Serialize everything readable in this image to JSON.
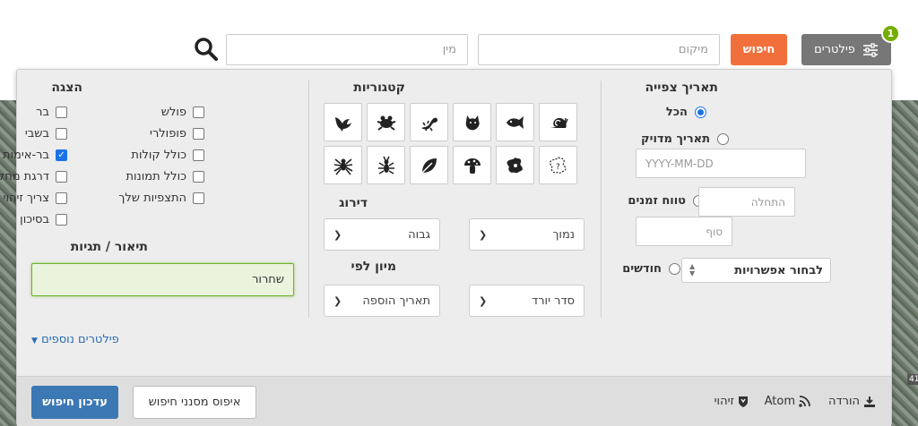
{
  "search": {
    "taxon_placeholder": "מין",
    "place_placeholder": "מיקום",
    "go_label": "חיפוש",
    "filters_label": "פילטרים",
    "filters_count": "1"
  },
  "date": {
    "heading": "תאריך צפייה",
    "any_label": "הכל",
    "exact_label": "תאריך מדויק",
    "exact_placeholder": "YYYY-MM-DD",
    "range_label": "טווח זמנים",
    "range_start_placeholder": "התחלה",
    "range_end_placeholder": "סוף",
    "months_label": "חודשים",
    "months_select": "לבחור אפשרויות"
  },
  "categories": {
    "heading": "קטגוריות",
    "icons": [
      "bird-icon",
      "amphibian-icon",
      "reptile-icon",
      "mammal-icon",
      "fish-icon",
      "mollusk-icon",
      "arachnid-icon",
      "insect-icon",
      "plant-icon",
      "fungi-icon",
      "protozoa-icon",
      "unknown-icon"
    ]
  },
  "rank": {
    "heading": "דירוג",
    "high": "גבוה",
    "low": "נמוך"
  },
  "sort": {
    "heading": "מיון לפי",
    "by": "תאריך הוספה",
    "order": "סדר יורד"
  },
  "display": {
    "heading": "הצגה",
    "col_right": [
      {
        "label": "פולש",
        "checked": false
      },
      {
        "label": "פופולרי",
        "checked": false
      },
      {
        "label": "כולל קולות",
        "checked": false
      },
      {
        "label": "כולל תמונות",
        "checked": false
      },
      {
        "label": "התצפיות שלך",
        "checked": false
      }
    ],
    "col_left": [
      {
        "label": "בר",
        "checked": false
      },
      {
        "label": "בשבי",
        "checked": false
      },
      {
        "label": "בר-אימות",
        "checked": true
      },
      {
        "label": "דרגת מחקר",
        "checked": false
      },
      {
        "label": "צריך זיהוי",
        "checked": false
      },
      {
        "label": "בסיכון",
        "checked": false
      }
    ]
  },
  "description": {
    "heading": "תיאור / תגיות",
    "value": "שחרור"
  },
  "more_filters": "פילטרים נוספים",
  "footer": {
    "download": "הורדה",
    "atom": "Atom",
    "identify": "זיהוי",
    "reset": "איפוס מסנני חיפוש",
    "update": "עדכון חיפוש"
  },
  "map": {
    "scale_label": "41"
  },
  "colors": {
    "accent_orange": "#f16f3a",
    "badge_green": "#74ac00",
    "primary_blue": "#3c78b4",
    "check_blue": "#1a73e8"
  }
}
